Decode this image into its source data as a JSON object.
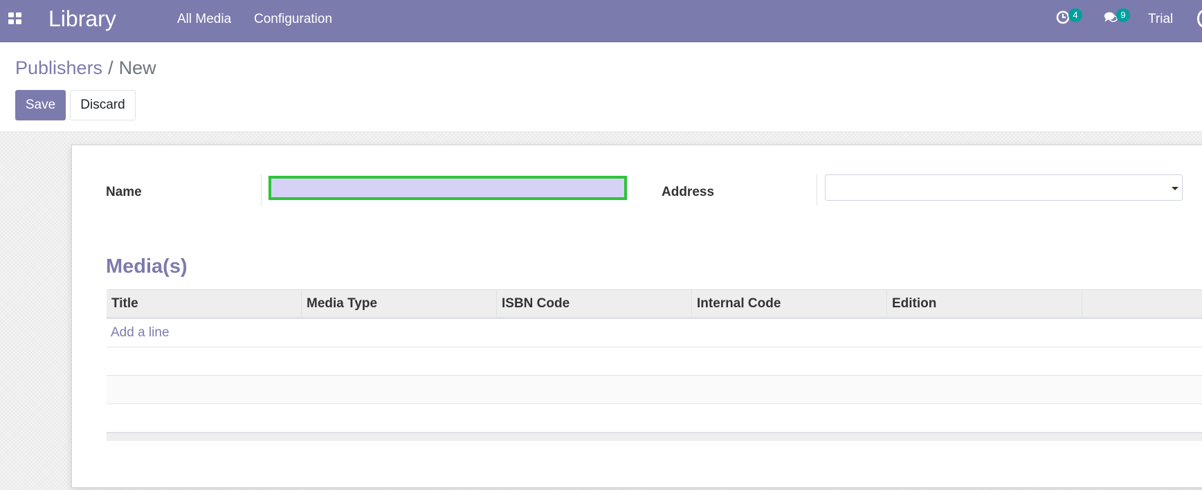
{
  "navbar": {
    "app_title": "Library",
    "menu": [
      {
        "label": "All Media"
      },
      {
        "label": "Configuration"
      }
    ],
    "activity_count": "4",
    "message_count": "9",
    "user_name": "Trial"
  },
  "breadcrumb": {
    "parent": "Publishers",
    "separator": "/",
    "current": "New"
  },
  "buttons": {
    "save": "Save",
    "discard": "Discard"
  },
  "form": {
    "name_label": "Name",
    "name_value": "",
    "address_label": "Address",
    "address_value": ""
  },
  "media_section": {
    "title": "Media(s)",
    "columns": [
      "Title",
      "Media Type",
      "ISBN Code",
      "Internal Code",
      "Edition"
    ],
    "add_line_label": "Add a line",
    "rows": []
  },
  "colors": {
    "brand": "#7c7bad",
    "badge": "#00a09d",
    "focus_border": "#2dc43b",
    "input_fill": "#d5d2f5"
  },
  "icons": [
    "apps-grid-icon",
    "activity-clock-icon",
    "messages-chat-icon",
    "caret-down-icon"
  ]
}
